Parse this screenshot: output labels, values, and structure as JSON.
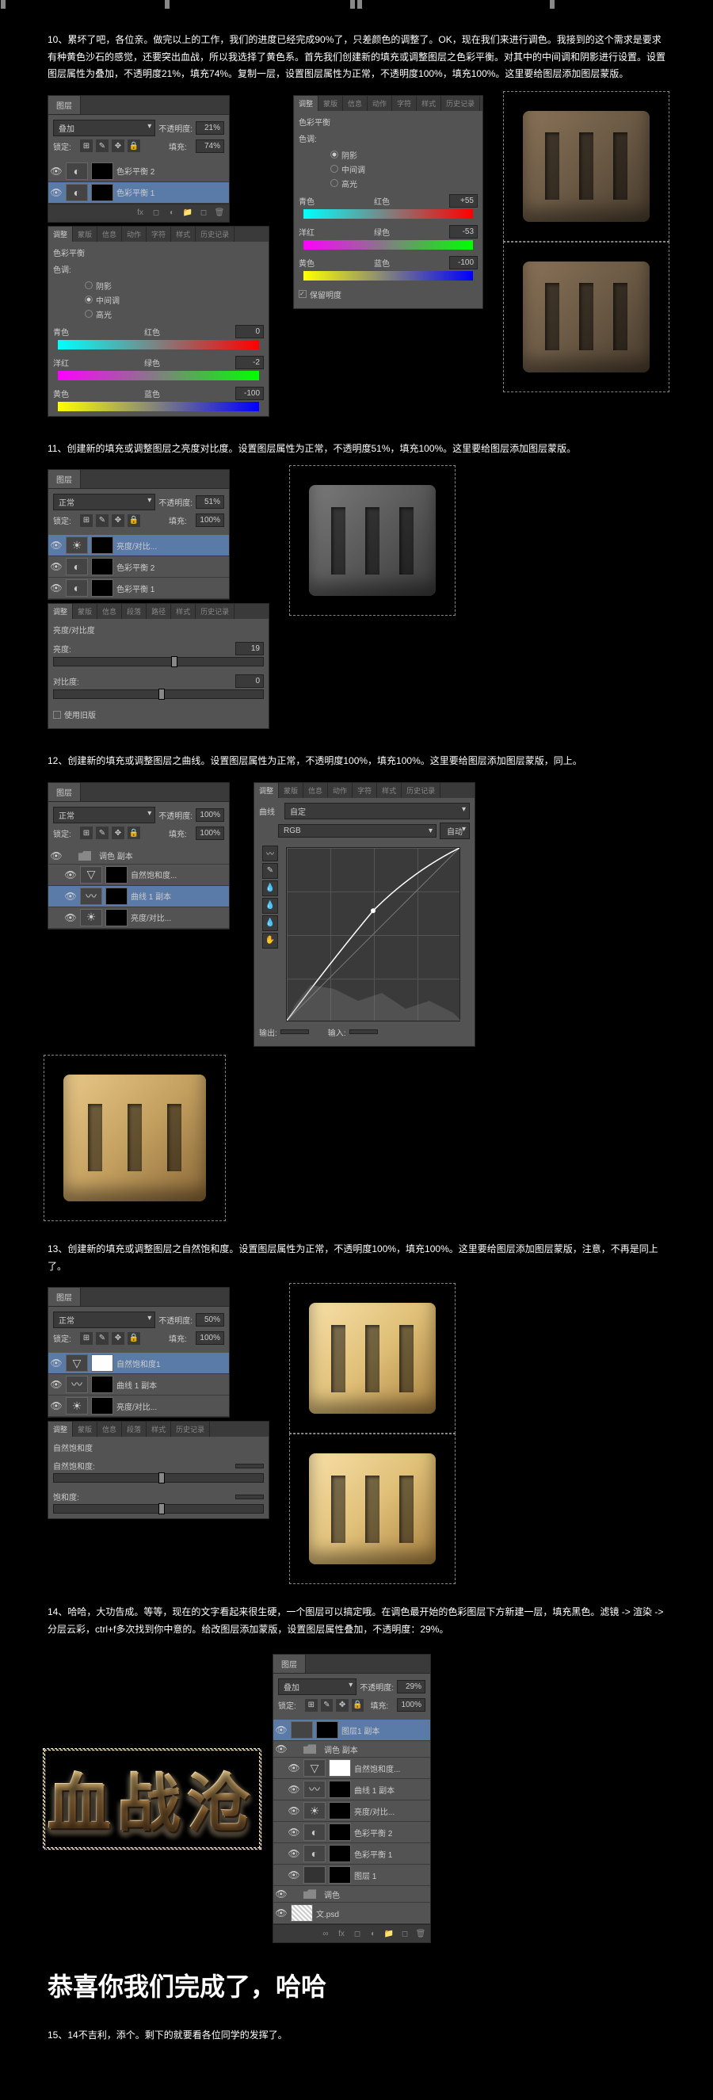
{
  "steps": {
    "s10": {
      "num": "10、",
      "text": "累坏了吧，各位亲。做完以上的工作，我们的进度已经完成90%了，只差颜色的调整了。OK，现在我们来进行调色。我接到的这个需求是要求有种黄色沙石的感觉，还要突出血战，所以我选择了黄色系。首先我们创建新的填充或调整图层之色彩平衡。对其中的中间调和阴影进行设置。设置图层属性为叠加，不透明度21%，填充74%。复制一层，设置图层属性为正常，不透明度100%，填充100%。这里要给图层添加图层蒙版。"
    },
    "s11": {
      "num": "11、",
      "text": "创建新的填充或调整图层之亮度对比度。设置图层属性为正常，不透明度51%，填充100%。这里要给图层添加图层蒙版。"
    },
    "s12": {
      "num": "12、",
      "text": "创建新的填充或调整图层之曲线。设置图层属性为正常，不透明度100%，填充100%。这里要给图层添加图层蒙版，同上。"
    },
    "s13": {
      "num": "13、",
      "text": "创建新的填充或调整图层之自然饱和度。设置图层属性为正常，不透明度100%，填充100%。这里要给图层添加图层蒙版，注意，不再是同上了。"
    },
    "s14": {
      "num": "14、",
      "text": "哈哈，大功告成。等等，现在的文字看起来很生硬，一个图层可以搞定哦。在调色最开始的色彩图层下方新建一层，填充黑色。滤镜 -> 渲染 -> 分层云彩，ctrl+f多次找到你中意的。给改图层添加蒙版，设置图层属性叠加，不透明度：29%。"
    },
    "s15": {
      "num": "15、",
      "text": "14不吉利，添个。剩下的就要看各位同学的发挥了。"
    }
  },
  "congrats_text": "恭喜你我们完成了，哈哈",
  "big_text": "血战沧",
  "panel_labels": {
    "layers_tab": "图层",
    "blend_overlay": "叠加",
    "blend_normal": "正常",
    "opacity_label": "不透明度:",
    "fill_label": "填充:",
    "lock_label": "锁定:",
    "opacity_21": "21%",
    "opacity_51": "51%",
    "opacity_50": "50%",
    "opacity_100": "100%",
    "opacity_29": "29%",
    "fill_74": "74%",
    "fill_100": "100%",
    "color_balance_title": "色彩平衡",
    "tone_label": "色调:",
    "shadows": "阴影",
    "midtones": "中间调",
    "highlights": "高光",
    "cyan": "青色",
    "red": "红色",
    "magenta": "洋红",
    "green": "绿色",
    "yellow": "黄色",
    "blue": "蓝色",
    "preserve_lum": "保留明度",
    "brightness_contrast": "亮度/对比度",
    "brightness": "亮度:",
    "contrast": "对比度:",
    "use_legacy": "使用旧版",
    "curves": "曲线",
    "custom": "自定",
    "rgb": "RGB",
    "auto": "自动",
    "output": "输出:",
    "input": "输入:",
    "vibrance": "自然饱和度",
    "vibrance_label": "自然饱和度:",
    "saturation": "饱和度:",
    "adj_tabs": [
      "调整",
      "蒙版",
      "信息",
      "动作",
      "蒙版",
      "字符",
      "段落",
      "路径",
      "样式",
      "历史记录"
    ],
    "layer_color_balance_1": "色彩平衡 1",
    "layer_color_balance_2": "色彩平衡 2",
    "layer_bright_contrast": "亮度/对比...",
    "layer_curves_1": "曲线 1 副本",
    "layer_curves": "曲线 1",
    "layer_vibrance": "自然饱和度1",
    "layer_vibrance_copy": "自然饱和度...",
    "layer_group": "调色 副本",
    "layer_group2": "调色",
    "layer_1": "图层 1",
    "layer_copy": "副本"
  },
  "cb_values_mid": {
    "r": "0",
    "g": "-2",
    "b": "-100"
  },
  "cb_values_shadow": {
    "r": "+55",
    "g": "-53",
    "b": "-100"
  },
  "bc_values": {
    "brightness": "19",
    "contrast": "0"
  }
}
